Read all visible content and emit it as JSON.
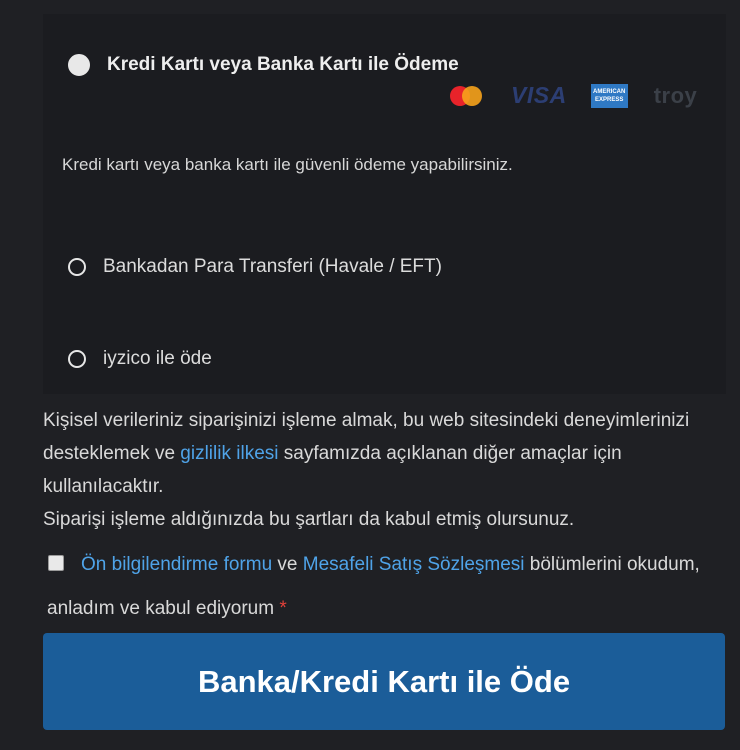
{
  "payment": {
    "card_label": "Kredi Kartı veya Banka Kartı ile Ödeme",
    "card_description": "Kredi kartı veya banka kartı ile güvenli ödeme yapabilirsiniz.",
    "card_logos": [
      "mastercard-logo",
      "visa-logo",
      "amex-logo",
      "troy-logo"
    ],
    "visa_text": "VISA",
    "amex_text_1": "AMERICAN",
    "amex_text_2": "EXPRESS",
    "troy_text": "troy",
    "bank_transfer_label": "Bankadan Para Transferi (Havale / EFT)",
    "iyzico_label": "iyzico ile öde",
    "selected": "card"
  },
  "privacy": {
    "text_1": "Kişisel verileriniz siparişinizi işleme almak, bu web sitesindeki deneyimlerinizi desteklemek ve ",
    "link": "gizlilik ilkesi",
    "text_2": " sayfamızda açıklanan diğer amaçlar için kullanılacaktır.",
    "text_3": "Siparişi işleme aldığınızda bu şartları da kabul etmiş olursunuz."
  },
  "terms": {
    "link_1": "Ön bilgilendirme formu",
    "connector": " ve ",
    "link_2": "Mesafeli Satış Sözleşmesi",
    "text": " bölümlerini okudum, anladım ve kabul ediyorum ",
    "required_mark": "*",
    "checked": false
  },
  "submit": {
    "label": "Banka/Kredi Kartı ile Öde"
  },
  "colors": {
    "background": "#1f2024",
    "link": "#4fa3e8",
    "button": "#1b5d99",
    "required": "#e2413a"
  }
}
